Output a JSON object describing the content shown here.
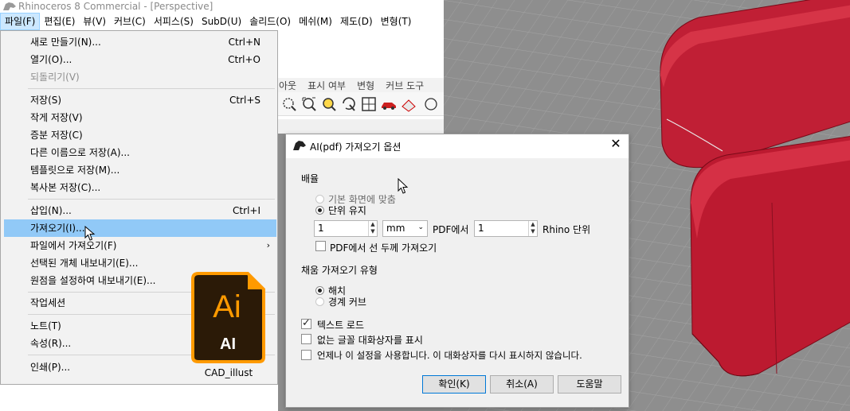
{
  "window": {
    "title": "Rhinoceros 8 Commercial - [Perspective]"
  },
  "menubar": [
    {
      "label": "파일(F)"
    },
    {
      "label": "편집(E)"
    },
    {
      "label": "뷰(V)"
    },
    {
      "label": "커브(C)"
    },
    {
      "label": "서피스(S)"
    },
    {
      "label": "SubD(U)"
    },
    {
      "label": "솔리드(O)"
    },
    {
      "label": "메쉬(M)"
    },
    {
      "label": "제도(D)"
    },
    {
      "label": "변형(T)"
    }
  ],
  "background_tabs": [
    "아웃",
    "표시 여부",
    "변형",
    "커브 도구"
  ],
  "file_menu": {
    "items": [
      {
        "label": "새로 만들기(N)...",
        "shortcut": "Ctrl+N"
      },
      {
        "label": "열기(O)...",
        "shortcut": "Ctrl+O"
      },
      {
        "label": "되돌리기(V)",
        "shortcut": ""
      },
      {
        "label": "저장(S)",
        "shortcut": "Ctrl+S"
      },
      {
        "label": "작게 저장(V)",
        "shortcut": ""
      },
      {
        "label": "증분 저장(C)",
        "shortcut": ""
      },
      {
        "label": "다른 이름으로 저장(A)...",
        "shortcut": ""
      },
      {
        "label": "템플릿으로 저장(M)...",
        "shortcut": ""
      },
      {
        "label": "복사본 저장(C)...",
        "shortcut": ""
      },
      {
        "label": "삽입(N)...",
        "shortcut": "Ctrl+I"
      },
      {
        "label": "가져오기(I)...",
        "shortcut": ""
      },
      {
        "label": "파일에서 가져오기(F)",
        "shortcut": ""
      },
      {
        "label": "선택된 개체 내보내기(E)...",
        "shortcut": ""
      },
      {
        "label": "원점을 설정하여 내보내기(E)...",
        "shortcut": ""
      },
      {
        "label": "작업세션",
        "shortcut": ""
      },
      {
        "label": "노트(T)",
        "shortcut": ""
      },
      {
        "label": "속성(R)...",
        "shortcut": ""
      },
      {
        "label": "인쇄(P)...",
        "shortcut": ""
      }
    ]
  },
  "desktop_icon": {
    "glyph_top": "Ai",
    "glyph_bottom": "AI",
    "label": "CAD_illust",
    "color_bg": "#2b1a07",
    "color_accent": "#ff9a00"
  },
  "dialog": {
    "title": "AI(pdf) 가져오기 옵션",
    "scale_section": "배율",
    "radio_fit": "기본 화면에 맞춤",
    "radio_unit": "단위 유지",
    "scale_value_left": "1",
    "unit_select": "mm",
    "pdf_label": "PDF에서",
    "scale_value_right": "1",
    "rhino_unit_label": "Rhino 단위",
    "import_line_width": "PDF에서 선 두께 가져오기",
    "fill_section": "채움 가져오기 유형",
    "radio_hatch": "해치",
    "radio_boundary": "경계 커브",
    "load_text": "텍스트 로드",
    "show_missing_fonts": "없는 글꼴 대화상자를 표시",
    "always_use": "언제나 이 설정을 사용합니다. 이 대화상자를 다시 표시하지 않습니다.",
    "ok_button": "확인(K)",
    "cancel_button": "취소(A)",
    "help_button": "도움말"
  },
  "colors": {
    "model_red": "#c01f35",
    "viewport_gray": "#8e8e8e",
    "menu_highlight": "#91c9f7"
  }
}
